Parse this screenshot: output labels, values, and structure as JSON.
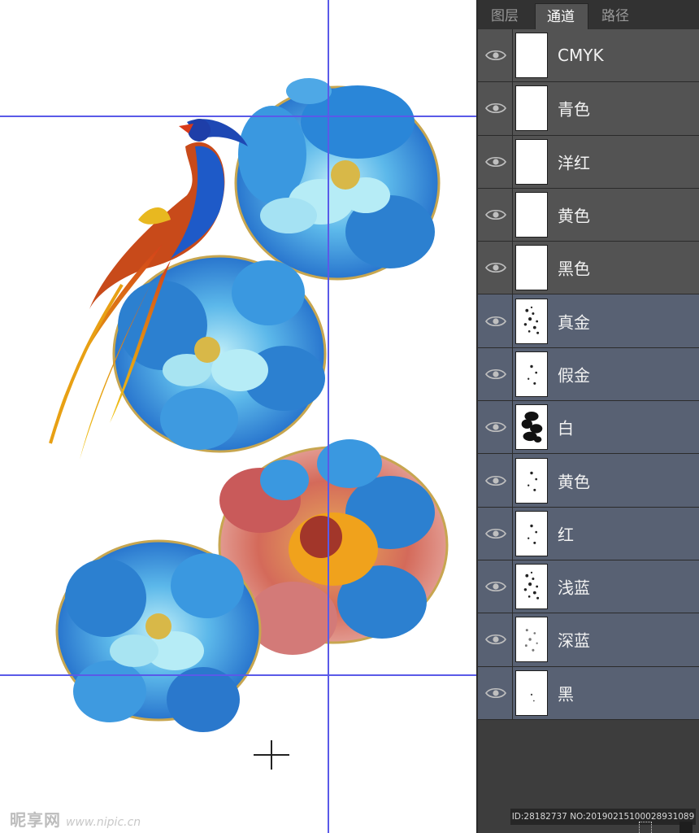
{
  "panel": {
    "tabs": [
      {
        "label": "图层",
        "active": false
      },
      {
        "label": "通道",
        "active": true
      },
      {
        "label": "路径",
        "active": false
      }
    ],
    "channels": [
      {
        "label": "CMYK",
        "kind": "composite",
        "thumb": "blank"
      },
      {
        "label": "青色",
        "kind": "composite",
        "thumb": "blank"
      },
      {
        "label": "洋红",
        "kind": "composite",
        "thumb": "blank"
      },
      {
        "label": "黄色",
        "kind": "composite",
        "thumb": "blank"
      },
      {
        "label": "黑色",
        "kind": "composite",
        "thumb": "blank"
      },
      {
        "label": "真金",
        "kind": "spot",
        "thumb": "speckle"
      },
      {
        "label": "假金",
        "kind": "spot",
        "thumb": "sparse"
      },
      {
        "label": "白",
        "kind": "spot",
        "thumb": "blobs"
      },
      {
        "label": "黄色",
        "kind": "spot",
        "thumb": "sparse"
      },
      {
        "label": "红",
        "kind": "spot",
        "thumb": "sparse"
      },
      {
        "label": "浅蓝",
        "kind": "spot",
        "thumb": "speckle"
      },
      {
        "label": "深蓝",
        "kind": "spot",
        "thumb": "speckle-light"
      },
      {
        "label": "黑",
        "kind": "spot",
        "thumb": "tiny"
      }
    ]
  },
  "footer": {
    "image_id": "ID:28182737 NO:20190215100028931089"
  },
  "watermark": {
    "logo": "昵享网",
    "url": "www.nipic.cn"
  },
  "colors": {
    "guide": "#5a5ae8",
    "panel_bg": "#3d3d3d",
    "row_composite": "#535353",
    "row_spot": "#586173",
    "flower_blue": "#1e78d2",
    "flower_light": "#a8e4f2",
    "flower_orange": "#f0a21c",
    "flower_red": "#c8525a",
    "bird_red": "#c8401a",
    "bird_yellow": "#e8b820"
  }
}
